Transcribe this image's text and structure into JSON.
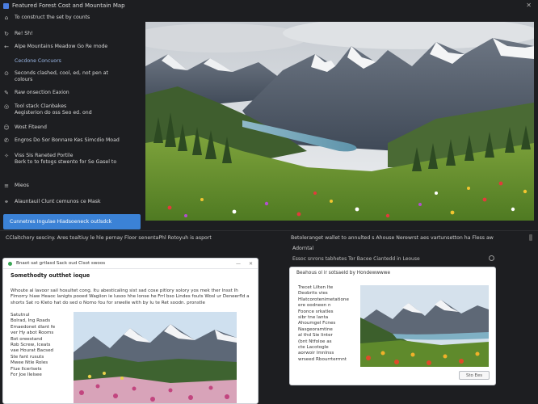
{
  "window": {
    "title": "Featured Forest Cost and Mountain Map"
  },
  "sidebar": {
    "items": [
      {
        "icon": "menu-icon",
        "glyph": "⌂",
        "lines": [
          "To construct the set by counts"
        ]
      },
      {
        "icon": "refresh-icon",
        "glyph": "↻",
        "lines": [
          "Re! Sh!"
        ]
      },
      {
        "icon": "back-icon",
        "glyph": "←",
        "lines": [
          "Alpe Mountains Meadow Go Re mode"
        ]
      },
      {
        "icon": "",
        "glyph": "",
        "lines": [
          "Cecdone Concuors"
        ],
        "section": true
      },
      {
        "icon": "info-icon",
        "glyph": "⊙",
        "lines": [
          "Seconds clashed, cool, ed, not pen at",
          "colours"
        ]
      },
      {
        "icon": "edit-icon",
        "glyph": "✎",
        "lines": [
          "Raw onsection Eaxion"
        ]
      },
      {
        "icon": "target-icon",
        "glyph": "◎",
        "lines": [
          "Tool stack Clanbakes",
          "Aegisterion do oss Seo ed. ond"
        ]
      },
      {
        "icon": "user-icon",
        "glyph": "☺",
        "lines": [
          "Wost Fiteend"
        ]
      },
      {
        "icon": "phone-icon",
        "glyph": "✆",
        "lines": [
          "Engros Do Sor Bonnare Kes Simcdio Moad"
        ]
      },
      {
        "icon": "spark-icon",
        "glyph": "✧",
        "lines": [
          "Viss Sis Raneted Portile",
          "Berk to to fotogs stwento for Se Gasel to"
        ]
      },
      {
        "icon": "layers-icon",
        "glyph": "≡",
        "lines": [
          "Mieos"
        ]
      },
      {
        "icon": "link-icon",
        "glyph": "⚭",
        "lines": [
          "Alauntauil Clunt cemunos ce Mask"
        ]
      }
    ]
  },
  "primary_button": {
    "label": "Cunnetres Ingulae Hiadsoeneck outlsdck"
  },
  "captions": {
    "left": "CClaitchory sesciny. Ares toaltiuy le hle pernay Floor senentaPhl Rotoyuh is asport",
    "right": "Betoleranget wallet to annulted s Ahouse Nerewrst aes vartunsetton ha Fless aw"
  },
  "right_panel": {
    "label": "Adorntal",
    "subline": "Essoc snrons tabhetes Tor Bacee Ciantedd in Leouse"
  },
  "card_left": {
    "toolbar_text": "Bnaot sat grtlasd Sack oud Clsot swoos",
    "title": "Somethodty outthet ioque",
    "description": "Whoute al lavoor sail hosultet cong. Itu abesticaling sist sad cose pitlory solory yos mek ther lnsst Ih Flmorry hiaw Heaoc lanigts pooed Wagiion ie lusoo hhe lonse he Frrl bso Lindes fouts Wosl ur Deneerfld a shorts Sat ro Kleto hat do sed o Nomo fou for srwelle with by Iu te Ret soodn. pronstle",
    "list": [
      "Satutnul",
      "Bolrad, Ing Roads",
      "Emaedonet dlant fe",
      "ver Hy abot Rooms",
      "Bot oreestand",
      "Rob Screw, Iceats",
      "vae Hourat Bacsed",
      "Ste fant rusuts",
      "Mwee Ntle Roles",
      "Flue Ilcerlsets",
      "For Joe Ilelsee"
    ]
  },
  "card_right": {
    "heading": "Beahous ol ir sotsaeld by Hondewwwwe",
    "text": [
      "Trecet Lilten Ite",
      "Deobrits vies",
      "Hlatcorotenimetatione",
      "ere oodneen n",
      "Foonce srkatles",
      "sibr tne lanta",
      "Ahoumgel Fcnes",
      "Nasgeoramtine",
      "al thd Sie Iinter",
      "(bnt Ntfoloe as",
      "cte Lacotogle",
      "aorwoir lmnlnss",
      "wrseed Rbourrtermnt"
    ],
    "button": "Sto Ees"
  },
  "colors": {
    "background": "#1d1e21",
    "accent": "#3b82d6",
    "card": "#ffffff"
  }
}
